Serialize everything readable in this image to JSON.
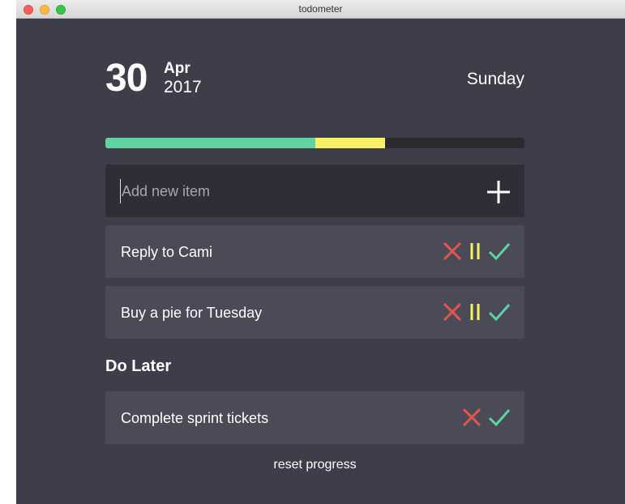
{
  "window": {
    "title": "todometer"
  },
  "date": {
    "day": "30",
    "month": "Apr",
    "year": "2017",
    "weekday": "Sunday"
  },
  "progress": {
    "done_fraction": 0.5,
    "later_fraction": 0.1667,
    "done_color": "#5fd4a0",
    "later_color": "#f8f165",
    "track_color": "#2b2a31"
  },
  "add_item": {
    "placeholder": "Add new item",
    "value": ""
  },
  "items": [
    {
      "text": "Reply to Cami"
    },
    {
      "text": "Buy a pie for Tuesday"
    }
  ],
  "later_section": {
    "title": "Do Later",
    "items": [
      {
        "text": "Complete sprint tickets"
      }
    ]
  },
  "reset_label": "reset progress",
  "icons": {
    "delete": "x-icon",
    "pause": "pause-icon",
    "done": "check-icon",
    "add": "plus-icon"
  },
  "colors": {
    "delete": "#e2574c",
    "pause": "#f8f165",
    "done": "#5fd4a0",
    "background": "#3e3d4a"
  }
}
